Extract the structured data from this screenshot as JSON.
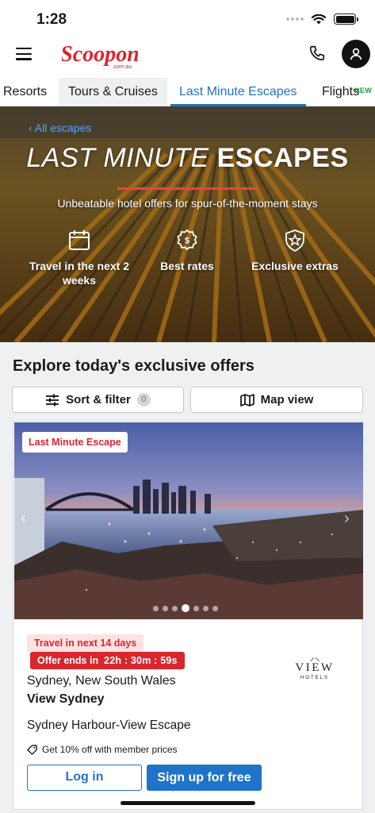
{
  "status_bar": {
    "time": "1:28"
  },
  "header": {
    "logo_text": "Scoopon",
    "logo_sub": ".com.au"
  },
  "tabs": [
    {
      "label": "Resorts"
    },
    {
      "label": "Tours & Cruises"
    },
    {
      "label": "Last Minute Escapes",
      "active": true
    },
    {
      "label": "Flights",
      "badge": "NEW"
    }
  ],
  "hero": {
    "back_link": "All escapes",
    "title_italic": "LAST MINUTE",
    "title_bold": "ESCAPES",
    "subtitle": "Unbeatable hotel offers for spur-of-the-moment stays",
    "features": [
      {
        "icon": "calendar-icon",
        "label": "Travel in the next 2 weeks"
      },
      {
        "icon": "award-ribbon-icon",
        "label": "Best rates"
      },
      {
        "icon": "star-shield-icon",
        "label": "Exclusive extras"
      }
    ]
  },
  "section": {
    "title": "Explore today's exclusive offers",
    "sort_filter_label": "Sort & filter",
    "filter_count": "0",
    "map_view_label": "Map view"
  },
  "card": {
    "image_tag": "Last Minute Escape",
    "carousel": {
      "count": 7,
      "active_index": 3
    },
    "travel_tag": "Travel in next 14 days",
    "offer_prefix": "Offer ends in",
    "countdown": "22h : 30m : 59s",
    "location": "Sydney, New South Wales",
    "hotel_name": "View Sydney",
    "deal_title": "Sydney Harbour-View Escape",
    "member_text": "Get 10% off with member prices",
    "brand": {
      "word": "VIEW",
      "sub": "HOTELS"
    },
    "login_label": "Log in",
    "signup_label": "Sign up for free"
  },
  "colors": {
    "brand_red": "#d9272e",
    "accent_blue": "#1f73c8",
    "badge_green": "#1a9c3a"
  }
}
